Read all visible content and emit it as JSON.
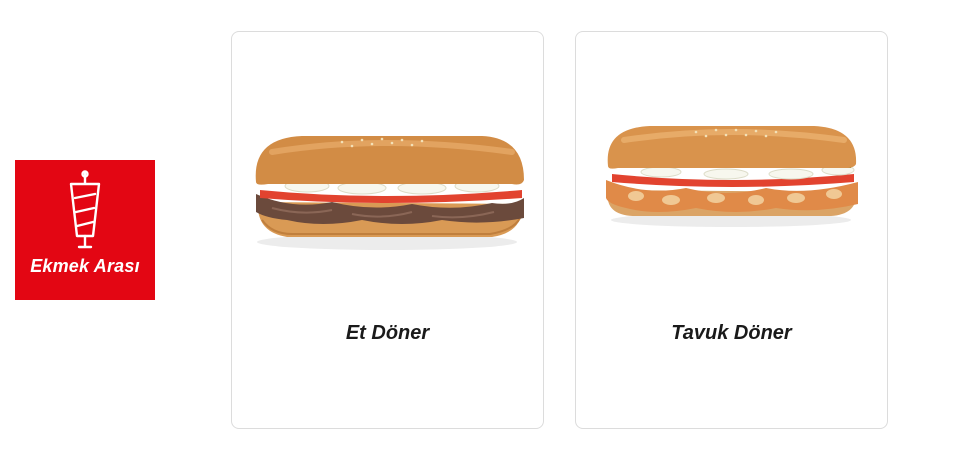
{
  "category": {
    "label": "Ekmek Arası",
    "icon": "doner-skewer-icon",
    "color": "#e30613"
  },
  "products": [
    {
      "name": "Et Döner",
      "image": "et-doner-sandwich-image"
    },
    {
      "name": "Tavuk Döner",
      "image": "tavuk-doner-sandwich-image"
    }
  ]
}
